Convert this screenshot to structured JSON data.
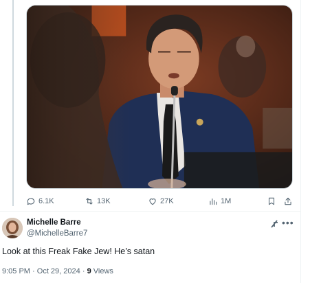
{
  "tweet": {
    "media_alt": "",
    "actions": {
      "replies": "6.1K",
      "reposts": "13K",
      "likes": "27K",
      "views": "1M"
    },
    "author": {
      "display_name": "Michelle Barre",
      "handle": "@MichelleBarre7"
    },
    "text": "Look at this Freak Fake Jew! He’s satan",
    "meta": {
      "time": "9:05 PM",
      "separator": "·",
      "date": "Oct 29, 2024",
      "views_count": "9",
      "views_label": "Views"
    }
  },
  "icons": {
    "reply": "reply-icon",
    "repost": "repost-icon",
    "like": "heart-icon",
    "views": "bar-chart-icon",
    "bookmark": "bookmark-icon",
    "share": "share-icon",
    "grok": "grok-icon",
    "more": "more-icon"
  },
  "colors": {
    "muted": "#536471",
    "text": "#0f1419",
    "border": "#cfd9de"
  }
}
